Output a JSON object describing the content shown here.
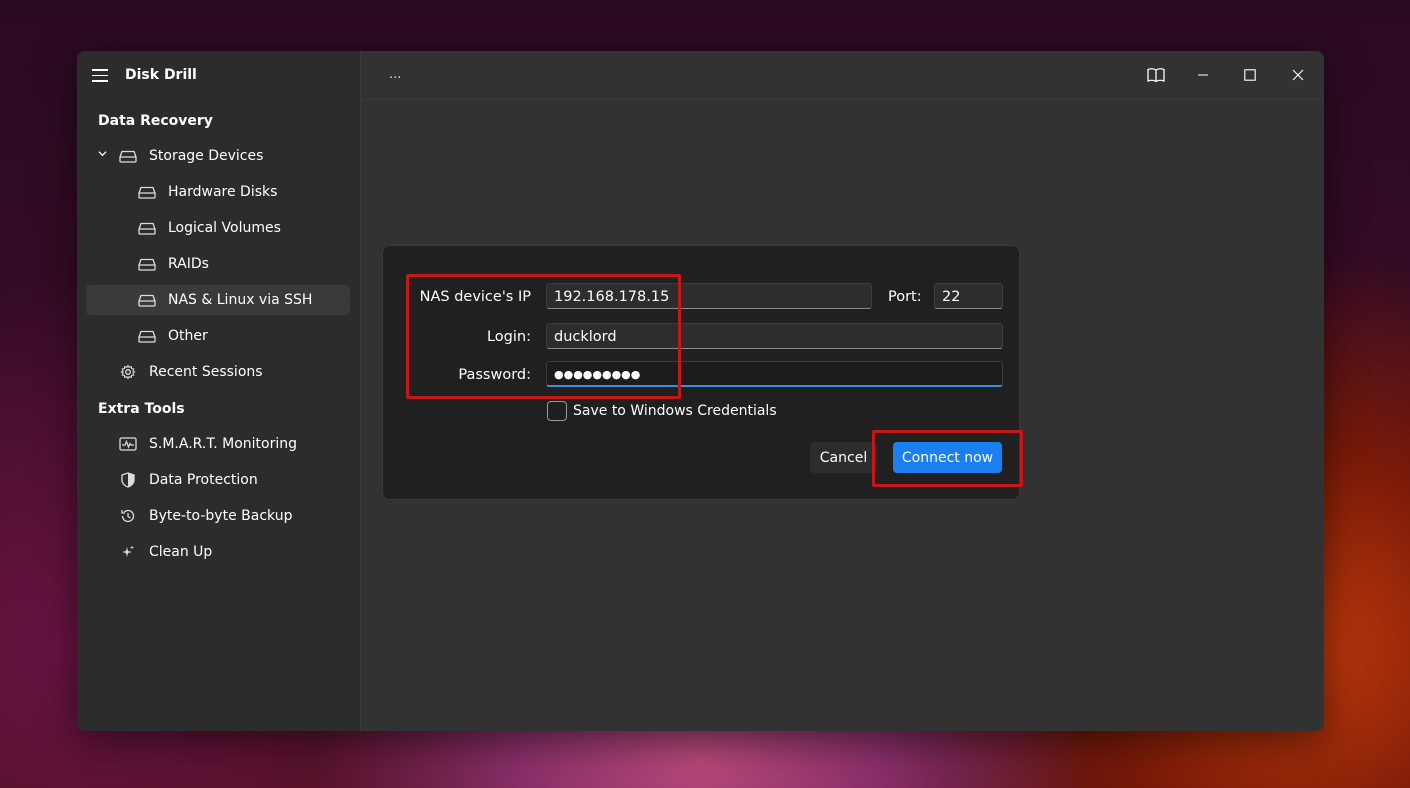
{
  "app": {
    "title": "Disk Drill",
    "breadcrumb": "..."
  },
  "sidebar": {
    "data_recovery_title": "Data Recovery",
    "storage_devices": "Storage Devices",
    "hardware_disks": "Hardware Disks",
    "logical_volumes": "Logical Volumes",
    "raids": "RAIDs",
    "nas_linux": "NAS & Linux via SSH",
    "other": "Other",
    "recent_sessions": "Recent Sessions",
    "extra_tools_title": "Extra Tools",
    "smart": "S.M.A.R.T. Monitoring",
    "data_protection": "Data Protection",
    "byte_backup": "Byte-to-byte Backup",
    "clean_up": "Clean Up"
  },
  "dialog": {
    "ip_label": "NAS device's IP",
    "ip_value": "192.168.178.15",
    "port_label": "Port:",
    "port_value": "22",
    "login_label": "Login:",
    "login_value": "ducklord",
    "password_label": "Password:",
    "password_mask": "●●●●●●●●●",
    "save_credentials_label": "Save to Windows Credentials",
    "save_credentials_checked": false,
    "cancel_label": "Cancel",
    "connect_label": "Connect now"
  },
  "colors": {
    "accent": "#1a7ff0",
    "highlight": "#c41818"
  }
}
